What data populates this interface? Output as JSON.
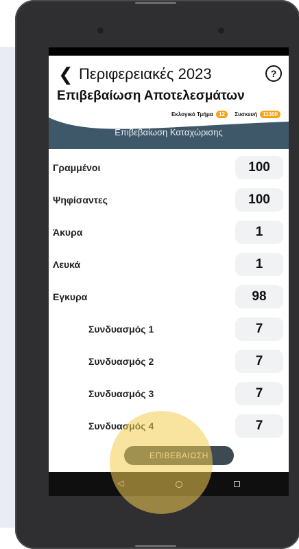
{
  "app": {
    "title": "Περιφερειακές 2023",
    "subtitle": "Επιβεβαίωση Αποτελεσμάτων"
  },
  "badges": {
    "station_label": "Εκλογικό Τμήμα",
    "station_value": "12",
    "device_label": "Συσκευή",
    "device_value": "11300"
  },
  "section": {
    "label": "Επιβεβαίωση Καταχώρισης"
  },
  "rows": [
    {
      "label": "Γραμμένοι",
      "value": "100"
    },
    {
      "label": "Ψηφίσαντες",
      "value": "100"
    },
    {
      "label": "Άκυρα",
      "value": "1"
    },
    {
      "label": "Λευκά",
      "value": "1"
    },
    {
      "label": "Εγκυρα",
      "value": "98"
    },
    {
      "label": "Συνδυασμός 1",
      "value": "7"
    },
    {
      "label": "Συνδυασμός 2",
      "value": "7"
    },
    {
      "label": "Συνδυασμός 3",
      "value": "7"
    },
    {
      "label": "Συνδυασμός 4",
      "value": "7"
    }
  ],
  "confirm_button": {
    "label": "ΕΠΙΒΕΒΑΙΩΣΗ"
  },
  "icons": {
    "back": "chevron-left-icon",
    "help": "question-circle-icon"
  },
  "colors": {
    "header_band": "#3f5869",
    "badge": "#f4a31a",
    "highlight": "#f2cc50"
  }
}
